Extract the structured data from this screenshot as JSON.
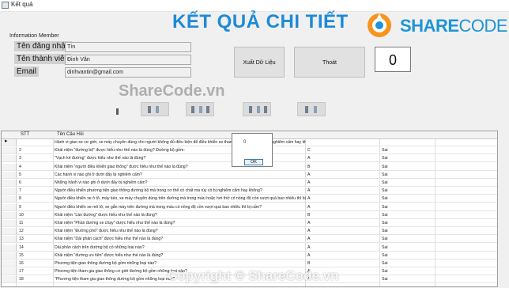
{
  "window": {
    "title": "Kết quả"
  },
  "header": {
    "title": "KẾT QUẢ CHI TIẾT"
  },
  "logo": {
    "text_bold": "SHARE",
    "text_thin": "CODE.vn"
  },
  "info": {
    "group_label": "Information Member",
    "username_label": "Tên đăng nhập",
    "username_value": "Tín",
    "fullname_label": "Tên thành viên",
    "fullname_value": "Đinh Văn",
    "email_label": "Email",
    "email_value": "dinhvantin@gmail.com"
  },
  "actions": {
    "export_label": "Xuất Dữ Liệu",
    "exit_label": "Thoát",
    "score": "0"
  },
  "grid": {
    "headers": {
      "stt": "STT",
      "question": "Tên Câu Hỏi",
      "answer": "",
      "result": ""
    },
    "rows": [
      {
        "stt": "",
        "question": "Hành vi giao xe cơ giới, xe máy chuyên dùng cho người không đủ điều kiện để điều khiển xe tham gia giao thông có bị nghiêm cấm hay không?",
        "answer": "",
        "result": ""
      },
      {
        "stt": "2",
        "question": "Khái niệm \"đường bộ\" được hiểu như thế nào là đúng? Đường bộ gồm:",
        "answer": "C",
        "result": "Sai"
      },
      {
        "stt": "3",
        "question": "\"Vạch kẻ đường\" được hiểu như thế nào là đúng?",
        "answer": "A",
        "result": "Sai"
      },
      {
        "stt": "4",
        "question": "Khái niệm \"người điều khiển giao thông\" được hiểu như thế nào là đúng?",
        "answer": "B",
        "result": "Sai"
      },
      {
        "stt": "5",
        "question": "Các hành vi nào ghi ở dưới đây bị nghiêm cấm?",
        "answer": "A",
        "result": "Sai"
      },
      {
        "stt": "6",
        "question": "Những hành vi nào ghi ở dưới đây bị nghiêm cấm?",
        "answer": "A",
        "result": "Sai"
      },
      {
        "stt": "7",
        "question": "Người điều khiển phương tiện giao thông đường bộ mà trong cơ thể có chất ma túy có bị nghiêm cấm hay không?",
        "answer": "A",
        "result": "Sai"
      },
      {
        "stt": "8",
        "question": "Người điều khiển xe ô tô, máy kéo, xe máy chuyên dùng trên đường mà trong máu hoặc hơi thở có nồng độ cồn vượt quá bao nhiêu thì bị cấm?",
        "answer": "A",
        "result": "Sai"
      },
      {
        "stt": "9",
        "question": "Người điều khiển xe mô tô, xe gắn máy trên đường mà trong máu có nồng độ cồn vượt quá bao nhiêu thì bị cấm?",
        "answer": "A",
        "result": "Sai"
      },
      {
        "stt": "10",
        "question": "Khái niệm \"Làn đường\" được hiểu như thế nào là đúng?",
        "answer": "B",
        "result": "Sai"
      },
      {
        "stt": "11",
        "question": "Khái niệm \"Phần đường xe chạy\" được hiểu như thế nào là đúng?",
        "answer": "A",
        "result": "Sai"
      },
      {
        "stt": "12",
        "question": "Khái niệm \"Đường phố\" được hiểu như thế nào là đúng?",
        "answer": "A",
        "result": "Sai"
      },
      {
        "stt": "13",
        "question": "Khái niệm \"Dải phân cách\" được hiểu như thế nào là đúng?",
        "answer": "A",
        "result": "Sai"
      },
      {
        "stt": "14",
        "question": "Dải phân cách trên đường bộ có những loại nào?",
        "answer": "A",
        "result": "Sai"
      },
      {
        "stt": "15",
        "question": "Khái niệm \"đường ưu tiên\" được hiểu như thế nào là đúng?",
        "answer": "A",
        "result": "Sai"
      },
      {
        "stt": "16",
        "question": "Phương tiện giao thông đường bộ gồm những loại nào?",
        "answer": "B",
        "result": "Sai"
      },
      {
        "stt": "17",
        "question": "Phương tiện tham gia giao thông cơ giới đường bộ gồm những loại nào?",
        "answer": "A",
        "result": "Sai"
      },
      {
        "stt": "18",
        "question": "\"Phương tiện tham gia giao thông đường bộ gồm những loại nào?",
        "answer": "A",
        "result": "Sai"
      }
    ]
  },
  "dialog": {
    "message": "0",
    "ok_label": "OK"
  },
  "watermarks": {
    "center": "ShareCode.vn",
    "footer": "Copyright © ShareCode.vn"
  }
}
